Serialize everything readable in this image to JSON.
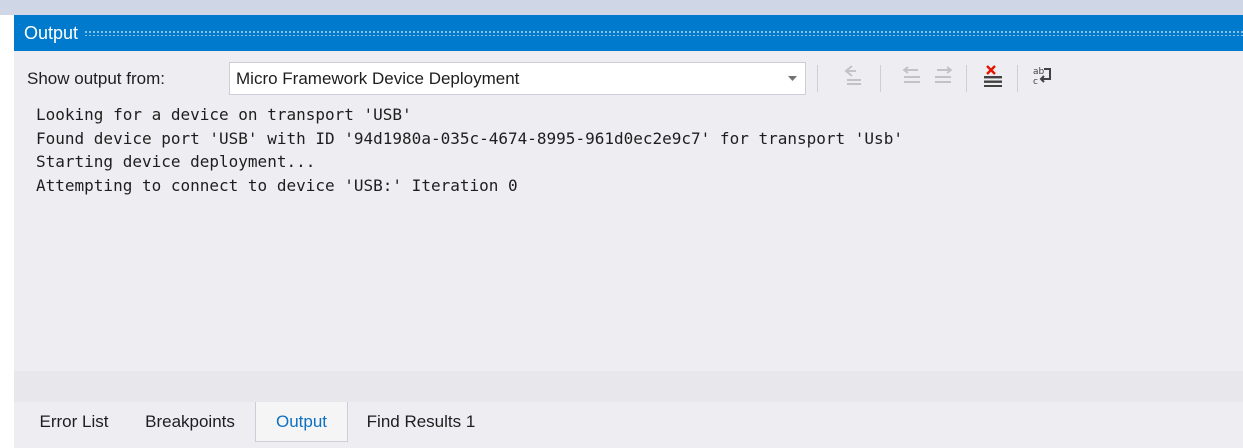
{
  "output_window": {
    "title": "Output"
  },
  "toolbar": {
    "show_output_label": "Show output from:",
    "source_selected": "Micro Framework Device Deployment",
    "buttons": [
      {
        "icon": "find-message-in-code-icon",
        "enabled": false
      },
      {
        "icon": "go-to-previous-message-icon",
        "enabled": false
      },
      {
        "icon": "go-to-next-message-icon",
        "enabled": false
      },
      {
        "icon": "clear-all-icon",
        "enabled": true
      },
      {
        "icon": "toggle-word-wrap-icon",
        "enabled": true
      }
    ]
  },
  "output": {
    "lines": [
      "Looking for a device on transport 'USB'",
      "Found device port 'USB' with ID '94d1980a-035c-4674-8995-961d0ec2e9c7' for transport 'Usb'",
      "Starting device deployment...",
      "Attempting to connect to device 'USB:' Iteration 0"
    ]
  },
  "tabs": [
    {
      "label": "Error List",
      "active": false
    },
    {
      "label": "Breakpoints",
      "active": false
    },
    {
      "label": "Output",
      "active": true
    },
    {
      "label": "Find Results 1",
      "active": false
    }
  ],
  "colors": {
    "titlebar_bg": "#007acc",
    "panel_bg": "#eeeef2",
    "active_tab_text": "#0e70c0",
    "clear_icon_red": "#e51400"
  }
}
